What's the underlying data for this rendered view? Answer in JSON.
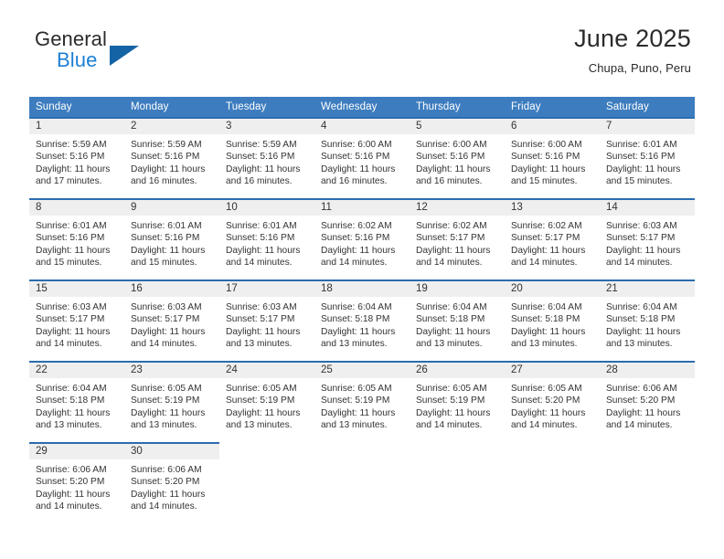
{
  "brand": {
    "line1": "General",
    "line2": "Blue",
    "flag_icon": "blue-triangle-flag-icon",
    "colors": {
      "dark": "#2b2b2b",
      "blue": "#1c7fd4",
      "flag": "#1464a5"
    }
  },
  "header": {
    "title": "June 2025",
    "location": "Chupa, Puno, Peru"
  },
  "theme": {
    "header_row_bg": "#3d7dbf",
    "header_row_text": "#ffffff",
    "day_band_bg": "#efefef",
    "row_divider": "#2b6cb0",
    "body_text": "#333333"
  },
  "calendar": {
    "weekday_headers": [
      "Sunday",
      "Monday",
      "Tuesday",
      "Wednesday",
      "Thursday",
      "Friday",
      "Saturday"
    ],
    "weeks": [
      [
        {
          "day": "1",
          "sunrise": "Sunrise: 5:59 AM",
          "sunset": "Sunset: 5:16 PM",
          "daylight_1": "Daylight: 11 hours",
          "daylight_2": "and 17 minutes."
        },
        {
          "day": "2",
          "sunrise": "Sunrise: 5:59 AM",
          "sunset": "Sunset: 5:16 PM",
          "daylight_1": "Daylight: 11 hours",
          "daylight_2": "and 16 minutes."
        },
        {
          "day": "3",
          "sunrise": "Sunrise: 5:59 AM",
          "sunset": "Sunset: 5:16 PM",
          "daylight_1": "Daylight: 11 hours",
          "daylight_2": "and 16 minutes."
        },
        {
          "day": "4",
          "sunrise": "Sunrise: 6:00 AM",
          "sunset": "Sunset: 5:16 PM",
          "daylight_1": "Daylight: 11 hours",
          "daylight_2": "and 16 minutes."
        },
        {
          "day": "5",
          "sunrise": "Sunrise: 6:00 AM",
          "sunset": "Sunset: 5:16 PM",
          "daylight_1": "Daylight: 11 hours",
          "daylight_2": "and 16 minutes."
        },
        {
          "day": "6",
          "sunrise": "Sunrise: 6:00 AM",
          "sunset": "Sunset: 5:16 PM",
          "daylight_1": "Daylight: 11 hours",
          "daylight_2": "and 15 minutes."
        },
        {
          "day": "7",
          "sunrise": "Sunrise: 6:01 AM",
          "sunset": "Sunset: 5:16 PM",
          "daylight_1": "Daylight: 11 hours",
          "daylight_2": "and 15 minutes."
        }
      ],
      [
        {
          "day": "8",
          "sunrise": "Sunrise: 6:01 AM",
          "sunset": "Sunset: 5:16 PM",
          "daylight_1": "Daylight: 11 hours",
          "daylight_2": "and 15 minutes."
        },
        {
          "day": "9",
          "sunrise": "Sunrise: 6:01 AM",
          "sunset": "Sunset: 5:16 PM",
          "daylight_1": "Daylight: 11 hours",
          "daylight_2": "and 15 minutes."
        },
        {
          "day": "10",
          "sunrise": "Sunrise: 6:01 AM",
          "sunset": "Sunset: 5:16 PM",
          "daylight_1": "Daylight: 11 hours",
          "daylight_2": "and 14 minutes."
        },
        {
          "day": "11",
          "sunrise": "Sunrise: 6:02 AM",
          "sunset": "Sunset: 5:16 PM",
          "daylight_1": "Daylight: 11 hours",
          "daylight_2": "and 14 minutes."
        },
        {
          "day": "12",
          "sunrise": "Sunrise: 6:02 AM",
          "sunset": "Sunset: 5:17 PM",
          "daylight_1": "Daylight: 11 hours",
          "daylight_2": "and 14 minutes."
        },
        {
          "day": "13",
          "sunrise": "Sunrise: 6:02 AM",
          "sunset": "Sunset: 5:17 PM",
          "daylight_1": "Daylight: 11 hours",
          "daylight_2": "and 14 minutes."
        },
        {
          "day": "14",
          "sunrise": "Sunrise: 6:03 AM",
          "sunset": "Sunset: 5:17 PM",
          "daylight_1": "Daylight: 11 hours",
          "daylight_2": "and 14 minutes."
        }
      ],
      [
        {
          "day": "15",
          "sunrise": "Sunrise: 6:03 AM",
          "sunset": "Sunset: 5:17 PM",
          "daylight_1": "Daylight: 11 hours",
          "daylight_2": "and 14 minutes."
        },
        {
          "day": "16",
          "sunrise": "Sunrise: 6:03 AM",
          "sunset": "Sunset: 5:17 PM",
          "daylight_1": "Daylight: 11 hours",
          "daylight_2": "and 14 minutes."
        },
        {
          "day": "17",
          "sunrise": "Sunrise: 6:03 AM",
          "sunset": "Sunset: 5:17 PM",
          "daylight_1": "Daylight: 11 hours",
          "daylight_2": "and 13 minutes."
        },
        {
          "day": "18",
          "sunrise": "Sunrise: 6:04 AM",
          "sunset": "Sunset: 5:18 PM",
          "daylight_1": "Daylight: 11 hours",
          "daylight_2": "and 13 minutes."
        },
        {
          "day": "19",
          "sunrise": "Sunrise: 6:04 AM",
          "sunset": "Sunset: 5:18 PM",
          "daylight_1": "Daylight: 11 hours",
          "daylight_2": "and 13 minutes."
        },
        {
          "day": "20",
          "sunrise": "Sunrise: 6:04 AM",
          "sunset": "Sunset: 5:18 PM",
          "daylight_1": "Daylight: 11 hours",
          "daylight_2": "and 13 minutes."
        },
        {
          "day": "21",
          "sunrise": "Sunrise: 6:04 AM",
          "sunset": "Sunset: 5:18 PM",
          "daylight_1": "Daylight: 11 hours",
          "daylight_2": "and 13 minutes."
        }
      ],
      [
        {
          "day": "22",
          "sunrise": "Sunrise: 6:04 AM",
          "sunset": "Sunset: 5:18 PM",
          "daylight_1": "Daylight: 11 hours",
          "daylight_2": "and 13 minutes."
        },
        {
          "day": "23",
          "sunrise": "Sunrise: 6:05 AM",
          "sunset": "Sunset: 5:19 PM",
          "daylight_1": "Daylight: 11 hours",
          "daylight_2": "and 13 minutes."
        },
        {
          "day": "24",
          "sunrise": "Sunrise: 6:05 AM",
          "sunset": "Sunset: 5:19 PM",
          "daylight_1": "Daylight: 11 hours",
          "daylight_2": "and 13 minutes."
        },
        {
          "day": "25",
          "sunrise": "Sunrise: 6:05 AM",
          "sunset": "Sunset: 5:19 PM",
          "daylight_1": "Daylight: 11 hours",
          "daylight_2": "and 13 minutes."
        },
        {
          "day": "26",
          "sunrise": "Sunrise: 6:05 AM",
          "sunset": "Sunset: 5:19 PM",
          "daylight_1": "Daylight: 11 hours",
          "daylight_2": "and 14 minutes."
        },
        {
          "day": "27",
          "sunrise": "Sunrise: 6:05 AM",
          "sunset": "Sunset: 5:20 PM",
          "daylight_1": "Daylight: 11 hours",
          "daylight_2": "and 14 minutes."
        },
        {
          "day": "28",
          "sunrise": "Sunrise: 6:06 AM",
          "sunset": "Sunset: 5:20 PM",
          "daylight_1": "Daylight: 11 hours",
          "daylight_2": "and 14 minutes."
        }
      ],
      [
        {
          "day": "29",
          "sunrise": "Sunrise: 6:06 AM",
          "sunset": "Sunset: 5:20 PM",
          "daylight_1": "Daylight: 11 hours",
          "daylight_2": "and 14 minutes."
        },
        {
          "day": "30",
          "sunrise": "Sunrise: 6:06 AM",
          "sunset": "Sunset: 5:20 PM",
          "daylight_1": "Daylight: 11 hours",
          "daylight_2": "and 14 minutes."
        },
        {
          "day": "",
          "sunrise": "",
          "sunset": "",
          "daylight_1": "",
          "daylight_2": ""
        },
        {
          "day": "",
          "sunrise": "",
          "sunset": "",
          "daylight_1": "",
          "daylight_2": ""
        },
        {
          "day": "",
          "sunrise": "",
          "sunset": "",
          "daylight_1": "",
          "daylight_2": ""
        },
        {
          "day": "",
          "sunrise": "",
          "sunset": "",
          "daylight_1": "",
          "daylight_2": ""
        },
        {
          "day": "",
          "sunrise": "",
          "sunset": "",
          "daylight_1": "",
          "daylight_2": ""
        }
      ]
    ]
  }
}
